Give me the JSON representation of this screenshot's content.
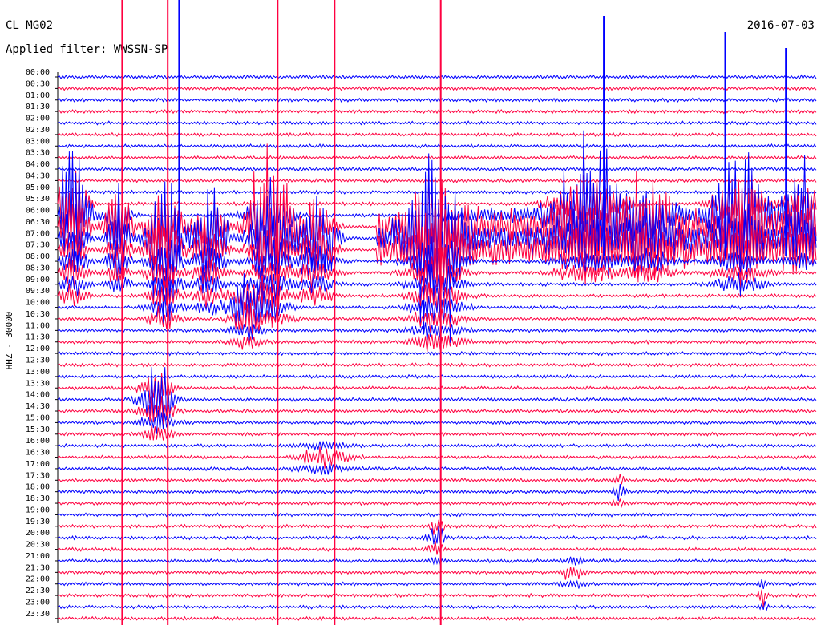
{
  "header": {
    "station": "CL MG02",
    "date": "2016-07-03",
    "filter": "Applied filter: WWSSN-SP"
  },
  "chart_data": {
    "type": "line",
    "title": "CL MG02",
    "subtitle": "Applied filter: WWSSN-SP",
    "ylabel": "HHZ - 30000",
    "xlabel": "",
    "grid": false,
    "series": [
      {
        "name": "",
        "color": "#0000ff"
      },
      {
        "name": "",
        "color": "#ff0040"
      }
    ],
    "rows": [
      "00:00",
      "00:30",
      "01:00",
      "01:30",
      "02:00",
      "02:30",
      "03:00",
      "03:30",
      "04:00",
      "04:30",
      "05:00",
      "05:30",
      "06:00",
      "06:30",
      "07:00",
      "07:30",
      "08:00",
      "08:30",
      "09:00",
      "09:30",
      "10:00",
      "10:30",
      "11:00",
      "11:30",
      "12:00",
      "12:30",
      "13:00",
      "13:30",
      "14:00",
      "14:30",
      "15:00",
      "15:30",
      "16:00",
      "16:30",
      "17:00",
      "17:30",
      "18:00",
      "18:30",
      "19:00",
      "19:30",
      "20:00",
      "20:30",
      "21:00",
      "21:30",
      "22:00",
      "22:30",
      "23:00",
      "23:30"
    ],
    "colors": {
      "blue": "#0000ff",
      "red": "#ff0040"
    }
  }
}
